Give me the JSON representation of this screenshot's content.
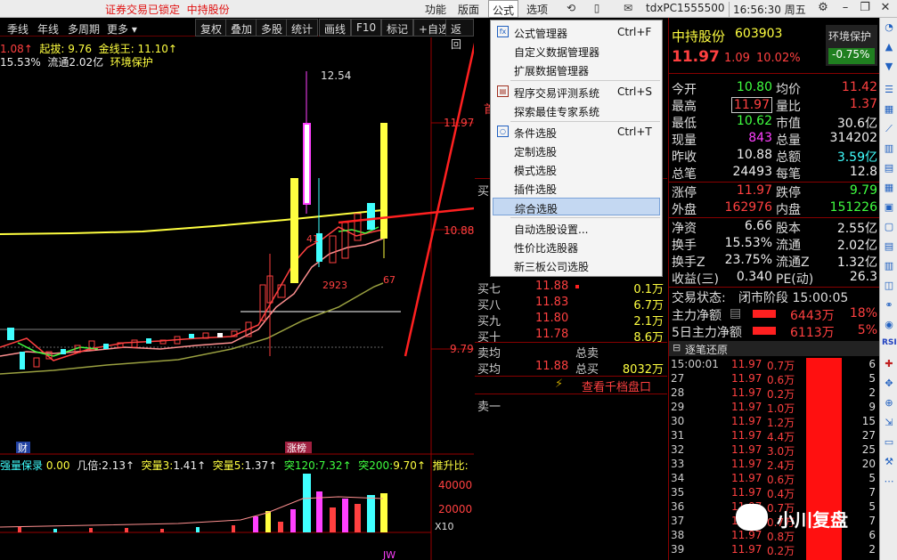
{
  "titlebar": {
    "lock_text": "证券交易已锁定",
    "stock_name": "中持股份",
    "menus": [
      "功能",
      "版面",
      "公式",
      "选项"
    ],
    "active_menu": "公式",
    "user": "tdxPC1555500",
    "time": "16:56:30 周五"
  },
  "period_bar": {
    "items": [
      "季线",
      "年线",
      "多周期",
      "更多"
    ],
    "buttons": [
      "复权",
      "叠加",
      "多股",
      "统计",
      "画线",
      "F10",
      "标记",
      "+自选",
      "返回"
    ]
  },
  "legend": {
    "line1_a": "1.08↑",
    "line1_b": "起拔: 9.76",
    "line1_c": "金线王: 11.10↑",
    "line2_a": "15.53%",
    "line2_b": "流通2.02亿",
    "line2_c": "环境保护",
    "bottom": [
      {
        "label": "强量保录",
        "value": "0.00"
      },
      {
        "label": "几倍:",
        "value": "2.13↑"
      },
      {
        "label": "突量3:",
        "value": "1.41↑"
      },
      {
        "label": "突量5:",
        "value": "1.37↑"
      },
      {
        "label": "突120:",
        "value": "7.32↑"
      },
      {
        "label": "突200:",
        "value": "9.70↑"
      },
      {
        "label": "推升比:",
        "value": ""
      }
    ]
  },
  "chart_labels": {
    "price_axis": [
      "11.97",
      "10.88",
      "9.79"
    ],
    "vol_axis": [
      "40000",
      "20000"
    ],
    "vol_unit": "X10",
    "peak": "12.54",
    "marker_41": "41",
    "marker_2923": "2923",
    "marker_67": "67",
    "tag_cai": "财",
    "tag_zhangbang": "涨榜",
    "bottom_tag": "JW"
  },
  "dropdown": {
    "items": [
      {
        "icon": "fx",
        "label": "公式管理器",
        "key": "Ctrl+F"
      },
      {
        "icon": "",
        "label": "自定义数据管理器",
        "key": ""
      },
      {
        "icon": "",
        "label": "扩展数据管理器",
        "key": ""
      },
      {
        "icon": "doc",
        "label": "程序交易评测系统",
        "key": "Ctrl+S"
      },
      {
        "icon": "",
        "label": "探索最佳专家系统",
        "key": ""
      },
      {
        "icon": "o",
        "label": "条件选股",
        "key": "Ctrl+T"
      },
      {
        "icon": "",
        "label": "定制选股",
        "key": ""
      },
      {
        "icon": "",
        "label": "模式选股",
        "key": ""
      },
      {
        "icon": "",
        "label": "插件选股",
        "key": ""
      },
      {
        "icon": "",
        "label": "综合选股",
        "key": ""
      },
      {
        "icon": "",
        "label": "自动选股设置...",
        "key": ""
      },
      {
        "icon": "",
        "label": "性价比选股器",
        "key": ""
      },
      {
        "icon": "",
        "label": "新三板公司选股",
        "key": ""
      }
    ],
    "selected": "综合选股"
  },
  "orderbook": {
    "partial_label": "首",
    "bids": [
      {
        "label": "买七",
        "price": "11.88",
        "vol": "0.1万"
      },
      {
        "label": "买八",
        "price": "11.83",
        "vol": "6.7万"
      },
      {
        "label": "买九",
        "price": "11.80",
        "vol": "2.1万"
      },
      {
        "label": "买十",
        "price": "11.78",
        "vol": "8.6万"
      }
    ],
    "hidden_bid_label": "买",
    "sell_avg_label": "卖均",
    "total_sell_label": "总卖",
    "buy_avg_label": "买均",
    "buy_avg_price": "11.88",
    "total_buy_label": "总买",
    "total_buy_vol": "8032万",
    "depth_button": "查看千档盘口",
    "sell1_label": "卖一"
  },
  "quote": {
    "name": "中持股份",
    "code": "603903",
    "sector": "环境保护",
    "sector_change": "-0.75%",
    "price": "11.97",
    "change": "1.09",
    "change_pct": "10.02%",
    "rows": [
      {
        "l1": "今开",
        "v1": "10.80",
        "c1": "green",
        "l2": "均价",
        "v2": "11.42",
        "c2": "red"
      },
      {
        "l1": "最高",
        "v1": "11.97",
        "c1": "red",
        "l2": "量比",
        "v2": "1.37",
        "c2": "red"
      },
      {
        "l1": "最低",
        "v1": "10.62",
        "c1": "green",
        "l2": "市值",
        "v2": "30.6亿",
        "c2": "white"
      },
      {
        "l1": "现量",
        "v1": "843",
        "c1": "magenta",
        "l2": "总量",
        "v2": "314202",
        "c2": "white"
      },
      {
        "l1": "昨收",
        "v1": "10.88",
        "c1": "white",
        "l2": "总额",
        "v2": "3.59亿",
        "c2": "cyan"
      },
      {
        "l1": "总笔",
        "v1": "24493",
        "c1": "white",
        "l2": "每笔",
        "v2": "12.8",
        "c2": "white"
      },
      {
        "l1": "涨停",
        "v1": "11.97",
        "c1": "red",
        "l2": "跌停",
        "v2": "9.79",
        "c2": "green"
      },
      {
        "l1": "外盘",
        "v1": "162976",
        "c1": "red",
        "l2": "内盘",
        "v2": "151226",
        "c2": "green"
      },
      {
        "l1": "净资",
        "v1": "6.66",
        "c1": "white",
        "l2": "股本",
        "v2": "2.55亿",
        "c2": "white"
      },
      {
        "l1": "换手",
        "v1": "15.53%",
        "c1": "white",
        "l2": "流通",
        "v2": "2.02亿",
        "c2": "white"
      },
      {
        "l1": "换手Z",
        "v1": "23.75%",
        "c1": "white",
        "l2": "流通Z",
        "v2": "1.32亿",
        "c2": "white"
      },
      {
        "l1": "收益(三)",
        "v1": "0.340",
        "c1": "white",
        "l2": "PE(动)",
        "v2": "26.3",
        "c2": "white"
      }
    ],
    "status_label": "交易状态:",
    "status_value": "闭市阶段 15:00:05",
    "main_flow_label": "主力净额",
    "main_flow_value": "6443万",
    "main_flow_pct": "18%",
    "main5_label": "5日主力净额",
    "main5_value": "6113万",
    "main5_pct": "5%",
    "ticks_title": "逐笔还原"
  },
  "ticks": [
    {
      "t": "15:00:01",
      "p": "11.97",
      "v": "0.7万",
      "n": "6"
    },
    {
      "t": "27",
      "p": "11.97",
      "v": "0.6万",
      "n": "5"
    },
    {
      "t": "28",
      "p": "11.97",
      "v": "0.2万",
      "n": "2"
    },
    {
      "t": "29",
      "p": "11.97",
      "v": "1.0万",
      "n": "9"
    },
    {
      "t": "30",
      "p": "11.97",
      "v": "1.2万",
      "n": "15"
    },
    {
      "t": "31",
      "p": "11.97",
      "v": "4.4万",
      "n": "27"
    },
    {
      "t": "32",
      "p": "11.97",
      "v": "3.0万",
      "n": "25"
    },
    {
      "t": "33",
      "p": "11.97",
      "v": "2.4万",
      "n": "20"
    },
    {
      "t": "34",
      "p": "11.97",
      "v": "0.6万",
      "n": "5"
    },
    {
      "t": "35",
      "p": "11.97",
      "v": "0.4万",
      "n": "7"
    },
    {
      "t": "36",
      "p": "11.97",
      "v": "0.7万",
      "n": "5"
    },
    {
      "t": "37",
      "p": "11.97",
      "v": "0.7万",
      "n": "7"
    },
    {
      "t": "38",
      "p": "11.97",
      "v": "0.8万",
      "n": "6"
    },
    {
      "t": "39",
      "p": "11.97",
      "v": "0.2万",
      "n": "2"
    }
  ],
  "watermark": "小川复盘",
  "colors": {
    "up": "#ff4040",
    "down": "#40ff40",
    "accent": "#ffff40"
  }
}
